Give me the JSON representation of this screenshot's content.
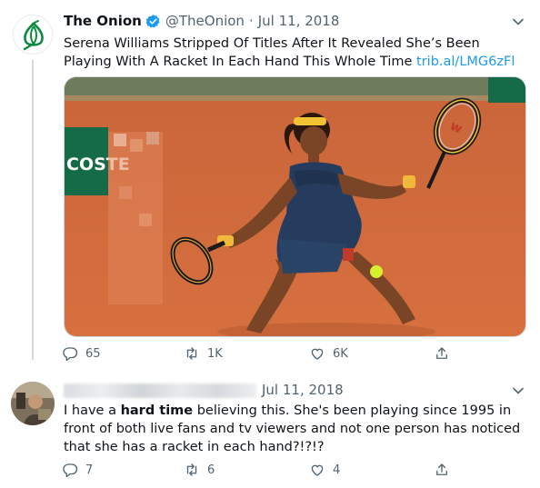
{
  "main_tweet": {
    "author_name": "The Onion",
    "handle": "@TheOnion",
    "separator": "·",
    "date": "Jul 11, 2018",
    "text": "Serena Williams Stripped Of Titles After It Revealed She’s Been Playing With A Racket In Each Hand This Whole Time ",
    "link": "trib.al/LMG6zFl",
    "photo_wall_text": "COSTE",
    "stats": {
      "replies": "65",
      "retweets": "1K",
      "likes": "6K"
    }
  },
  "reply_tweet": {
    "date": "Jul 11, 2018",
    "text_before": "I have a ",
    "text_bold": "hard time",
    "text_after": " believing this.  She's been playing since 1995 in front of both live fans and tv viewers and not one person has noticed that she has a racket in each hand?!?!?",
    "stats": {
      "replies": "7",
      "retweets": "6",
      "likes": "4"
    }
  },
  "colors": {
    "link": "#1d9bf0",
    "verified": "#1d9bf0",
    "onion_green": "#0b8a3e",
    "clay": "#d86a36",
    "muted": "#536471"
  },
  "icons": [
    "verified-badge-icon",
    "chevron-down-icon",
    "reply-icon",
    "retweet-icon",
    "like-icon",
    "share-icon",
    "onion-logo-icon"
  ]
}
